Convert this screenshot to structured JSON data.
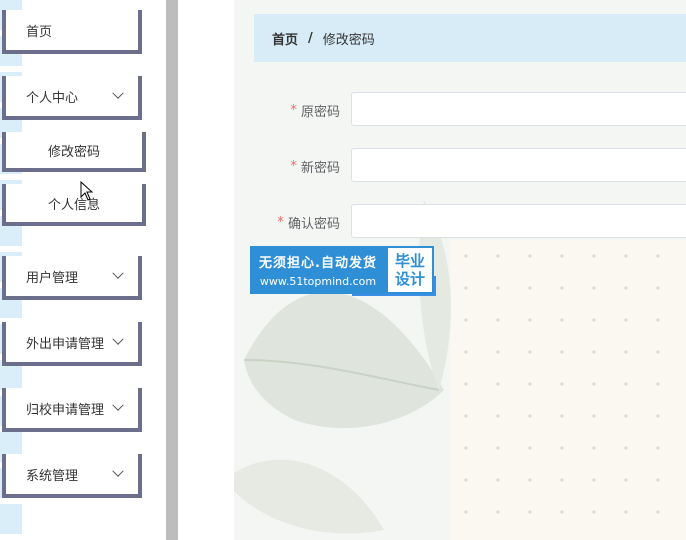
{
  "sidebar": {
    "items": [
      {
        "label": "首页"
      },
      {
        "label": "个人中心"
      },
      {
        "label": "修改密码"
      },
      {
        "label": "个人信息"
      },
      {
        "label": "用户管理"
      },
      {
        "label": "外出申请管理"
      },
      {
        "label": "归校申请管理"
      },
      {
        "label": "系统管理"
      }
    ]
  },
  "breadcrumb": {
    "home": "首页",
    "separator": "/",
    "current": "修改密码"
  },
  "form": {
    "required_mark": "*",
    "old_password_label": "原密码",
    "new_password_label": "新密码",
    "confirm_password_label": "确认密码"
  },
  "watermark": {
    "slogan": "无须担心.自动发货",
    "url": "www.51topmind.com",
    "badge_line1": "毕业",
    "badge_line2": "设计"
  },
  "colors": {
    "accent": "#2e8fd6",
    "breadcrumb_bg": "#d8ecf8",
    "sidebar_border": "#6b6f8c",
    "required": "#f56c6c"
  }
}
